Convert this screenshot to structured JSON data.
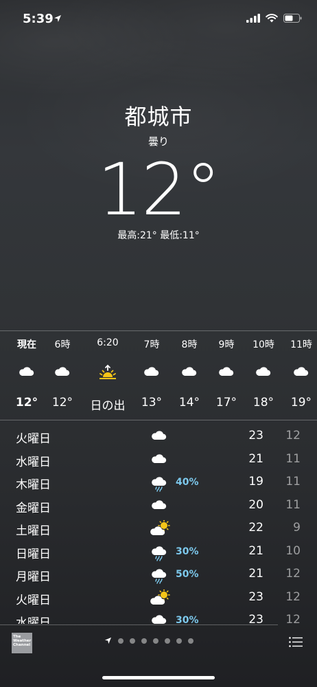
{
  "status_bar": {
    "time": "5:39"
  },
  "header": {
    "city": "都城市",
    "condition": "曇り",
    "temperature": "12°",
    "hilo": "最高:21° 最低:11°"
  },
  "hourly": [
    {
      "label": "現在",
      "icon": "cloud-icon",
      "temp": "12°",
      "bold": true
    },
    {
      "label": "6時",
      "icon": "cloud-icon",
      "temp": "12°"
    },
    {
      "label": "6:20",
      "icon": "sunrise-icon",
      "temp": "日の出"
    },
    {
      "label": "7時",
      "icon": "cloud-icon",
      "temp": "13°"
    },
    {
      "label": "8時",
      "icon": "cloud-icon",
      "temp": "14°"
    },
    {
      "label": "9時",
      "icon": "cloud-icon",
      "temp": "17°"
    },
    {
      "label": "10時",
      "icon": "cloud-icon",
      "temp": "18°"
    },
    {
      "label": "11時",
      "icon": "cloud-icon",
      "temp": "19°"
    }
  ],
  "daily": [
    {
      "day": "火曜日",
      "icon": "cloud-icon",
      "precip": "",
      "high": "23",
      "low": "12"
    },
    {
      "day": "水曜日",
      "icon": "cloud-icon",
      "precip": "",
      "high": "21",
      "low": "11"
    },
    {
      "day": "木曜日",
      "icon": "rain-cloud-icon",
      "precip": "40%",
      "high": "19",
      "low": "11"
    },
    {
      "day": "金曜日",
      "icon": "cloud-icon",
      "precip": "",
      "high": "20",
      "low": "11"
    },
    {
      "day": "土曜日",
      "icon": "partly-sunny-icon",
      "precip": "",
      "high": "22",
      "low": "9"
    },
    {
      "day": "日曜日",
      "icon": "rain-cloud-icon",
      "precip": "30%",
      "high": "21",
      "low": "10"
    },
    {
      "day": "月曜日",
      "icon": "rain-cloud-icon",
      "precip": "50%",
      "high": "21",
      "low": "12"
    },
    {
      "day": "火曜日",
      "icon": "partly-sunny-icon",
      "precip": "",
      "high": "23",
      "low": "12"
    },
    {
      "day": "水曜日",
      "icon": "cloud-icon",
      "precip": "30%",
      "high": "23",
      "low": "12"
    }
  ],
  "bottom_bar": {
    "logo_text": "The Weather Channel",
    "page_count": 7,
    "colors": {
      "precip": "#7cc8ec",
      "sun": "#f5c518"
    }
  }
}
